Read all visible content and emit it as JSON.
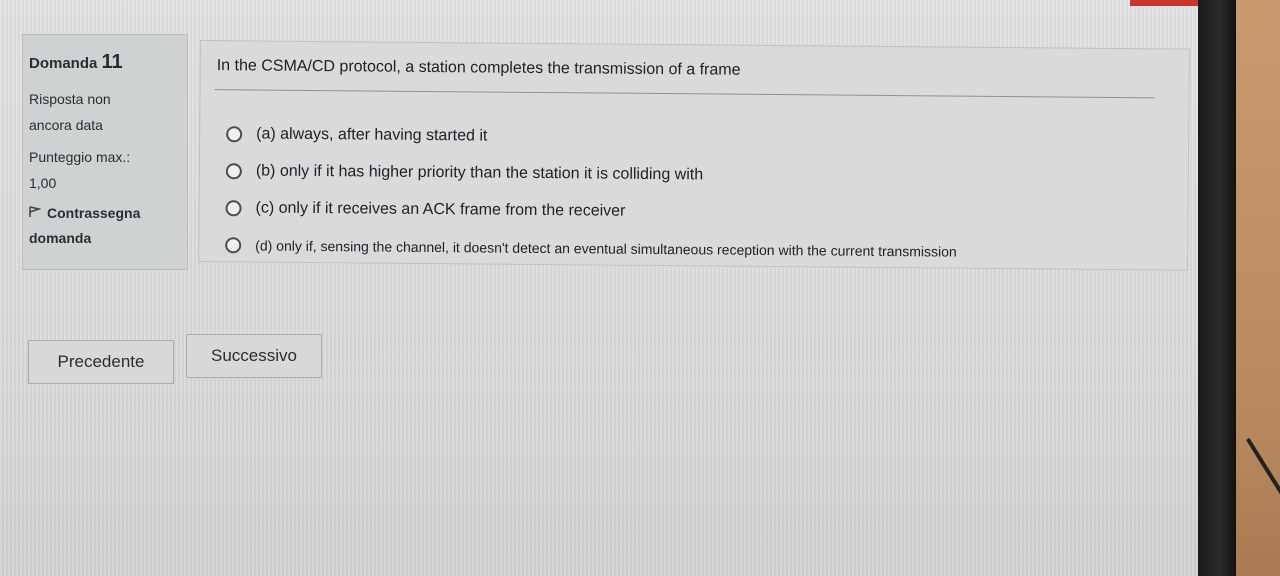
{
  "info": {
    "question_label": "Domanda",
    "question_number": "11",
    "status_line1": "Risposta non",
    "status_line2": "ancora data",
    "points_line1": "Punteggio max.:",
    "points_line2": "1,00",
    "flag_line1": "Contrassegna",
    "flag_line2": "domanda",
    "flag_icon": "flag-icon"
  },
  "question": {
    "text": "In the CSMA/CD protocol, a station completes the transmission of a frame",
    "options": [
      "(a) always, after having started it",
      "(b) only if it has higher priority than the station it is colliding with",
      "(c) only if it receives an ACK frame from the receiver",
      "(d) only if, sensing the channel, it doesn't detect an eventual simultaneous reception with the current transmission"
    ]
  },
  "nav": {
    "prev_label": "Precedente",
    "next_label": "Successivo"
  },
  "colors": {
    "background": "#d7d9da",
    "bezel": "#1a1a1a",
    "accent_red": "#c8352a"
  }
}
